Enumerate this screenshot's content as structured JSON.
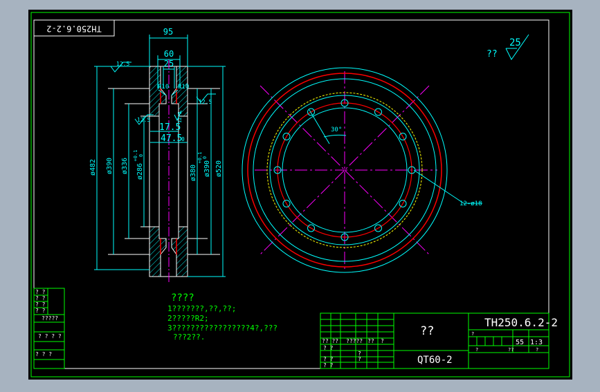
{
  "colors": {
    "window_bg": "#a7b3c0",
    "canvas_bg": "#000000",
    "frame": "#00ff00",
    "dim": "#00ffff",
    "centerline": "#ff00ff",
    "cut": "#ff0000",
    "hidden": "#ffff00",
    "note_text": "#00ff00",
    "white_text": "#ffffff"
  },
  "drawing": {
    "corner_code": "TH250.6.2-2",
    "roughness_general": "25",
    "roughness_prefix": "??",
    "section_view": {
      "top_dims": [
        "95",
        "60",
        "25"
      ],
      "roughness_left": "12.5",
      "roughness_right": "12.5",
      "roughness_bore": "12.5",
      "roughness_groove": "12.5",
      "radius_left": "R10",
      "radius_right": "R10",
      "groove_width": "17.5",
      "groove_depth": "47.5",
      "groove_depth_tol": "0",
      "dia_482": "ø482",
      "dia_390_left": "ø390",
      "dia_336": "ø336",
      "dia_286": "ø286",
      "dia_286_tol_up": "+0.1",
      "dia_286_tol_low": "0",
      "dia_380": "ø380",
      "dia_380_tol_up": "+0.1",
      "dia_380_tol_low": "0",
      "dia_390_right": "ø390",
      "dia_520": "ø520"
    },
    "front_view": {
      "angle_label": "30°",
      "holes_label": "12-ø18",
      "hole_count": 12
    }
  },
  "notes": {
    "title": "????",
    "line1": "1???????,??,??;",
    "line2": "2?????R2;",
    "line3": "3?????????????????4?,???",
    "line4": "???2??."
  },
  "side_table": {
    "rows": [
      "? ?",
      "? ?",
      "? ?",
      "? ?",
      "?????",
      "? ? ? ?",
      "? ? ?"
    ]
  },
  "title_block": {
    "drawing_number": "TH250.6.2-2",
    "part_name": "??",
    "material": "QT60-2",
    "weight": "55",
    "scale": "1:3",
    "header_cells": [
      "?? ??",
      "?????",
      "??",
      "?",
      "?",
      "?"
    ],
    "row_labels": [
      "? ?",
      "? ?",
      "? ?"
    ],
    "small_q1": "?",
    "small_q2": "??",
    "small_q3": "?",
    "small_q4": "?"
  }
}
